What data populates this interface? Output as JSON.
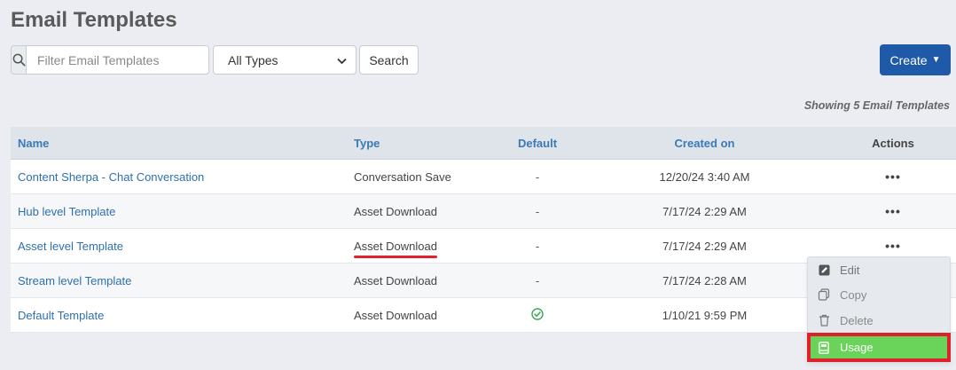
{
  "page": {
    "title": "Email Templates"
  },
  "toolbar": {
    "search_placeholder": "Filter Email Templates",
    "type_select_value": "All Types",
    "search_label": "Search",
    "create_label": "Create"
  },
  "summary": {
    "showing": "Showing 5 Email Templates"
  },
  "table": {
    "headers": {
      "name": "Name",
      "type": "Type",
      "default": "Default",
      "created": "Created on",
      "actions": "Actions"
    },
    "rows": [
      {
        "name": "Content Sherpa - Chat Conversation",
        "type": "Conversation Save",
        "default": "-",
        "created": "12/20/24 3:40 AM",
        "actions": "•••"
      },
      {
        "name": "Hub level Template",
        "type": "Asset Download",
        "default": "-",
        "created": "7/17/24 2:29 AM",
        "actions": "•••"
      },
      {
        "name": "Asset level Template",
        "type": "Asset Download",
        "default": "-",
        "created": "7/17/24 2:29 AM",
        "actions": "•••"
      },
      {
        "name": "Stream level Template",
        "type": "Asset Download",
        "default": "-",
        "created": "7/17/24 2:28 AM",
        "actions": ""
      },
      {
        "name": "Default Template",
        "type": "Asset Download",
        "default": "check-circle-icon",
        "created": "1/10/21 9:59 PM",
        "actions": ""
      }
    ]
  },
  "actions_menu": {
    "edit": "Edit",
    "copy": "Copy",
    "delete": "Delete",
    "usage": "Usage"
  },
  "colors": {
    "accent": "#1f5aa8",
    "link": "#2f6fae",
    "highlight_red": "#e0202a",
    "highlight_green": "#6ad45a",
    "check_green": "#3aa655"
  }
}
